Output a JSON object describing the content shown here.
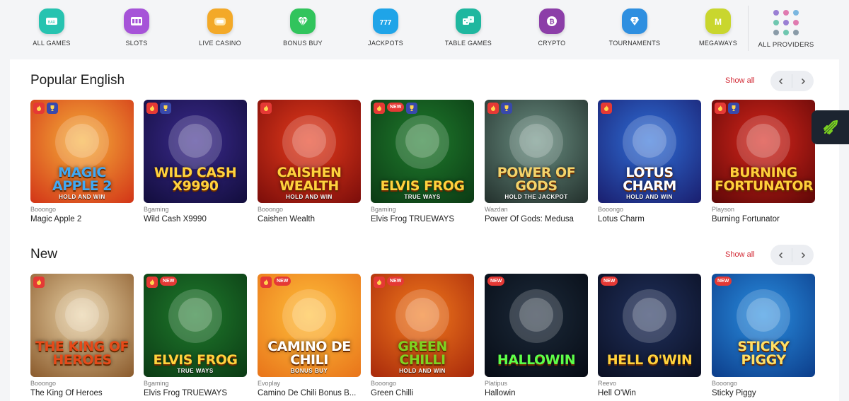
{
  "nav": {
    "categories": [
      {
        "label": "ALL GAMES",
        "icon": "all-games-icon",
        "color": "#27c3b0"
      },
      {
        "label": "SLOTS",
        "icon": "slots-icon",
        "color": "#a653d8"
      },
      {
        "label": "LIVE CASINO",
        "icon": "live-casino-icon",
        "color": "#f3a928"
      },
      {
        "label": "BONUS BUY",
        "icon": "diamond-icon",
        "color": "#31c45c"
      },
      {
        "label": "JACKPOTS",
        "icon": "jackpot-icon",
        "color": "#1fa4e8"
      },
      {
        "label": "TABLE GAMES",
        "icon": "dice-icon",
        "color": "#1fb79f"
      },
      {
        "label": "CRYPTO",
        "icon": "bitcoin-icon",
        "color": "#8c3ea8"
      },
      {
        "label": "TOURNAMENTS",
        "icon": "tournament-icon",
        "color": "#2e8fe0"
      },
      {
        "label": "MEGAWAYS",
        "icon": "megaways-icon",
        "color": "#c9d62e"
      }
    ],
    "providers_label": "ALL PROVIDERS",
    "provider_dot_colors": [
      "#9a7fd4",
      "#e07bb0",
      "#7ab7e0",
      "#6fc7b0",
      "#9a7fd4",
      "#e07bb0",
      "#8a9ba8",
      "#6fc7b0",
      "#8a9ba8"
    ]
  },
  "sections": [
    {
      "title": "Popular English",
      "show_all": "Show all",
      "games": [
        {
          "provider": "Booongo",
          "name": "Magic Apple 2",
          "art_title": "MAGIC APPLE 2",
          "art_sub": "HOLD AND WIN",
          "badges": [
            "hot",
            "cup"
          ],
          "bg": [
            "#f6b03a",
            "#d23417"
          ],
          "title_color": "#3fa9f5"
        },
        {
          "provider": "Bgaming",
          "name": "Wild Cash X9990",
          "art_title": "WILD CASH X9990",
          "art_sub": "",
          "badges": [
            "hot",
            "cup"
          ],
          "bg": [
            "#3a2a8c",
            "#120d3c"
          ],
          "title_color": "#ffd23d"
        },
        {
          "provider": "Booongo",
          "name": "Caishen Wealth",
          "art_title": "CAISHEN WEALTH",
          "art_sub": "HOLD AND WIN",
          "badges": [
            "hot"
          ],
          "bg": [
            "#e63b1c",
            "#7b0d0a"
          ],
          "title_color": "#ffd23d"
        },
        {
          "provider": "Bgaming",
          "name": "Elvis Frog TRUEWAYS",
          "art_title": "ELVIS FROG",
          "art_sub": "TRUE WAYS",
          "badges": [
            "hot",
            "new",
            "cup"
          ],
          "bg": [
            "#1f7a2c",
            "#0b3a14"
          ],
          "title_color": "#ffd23d"
        },
        {
          "provider": "Wazdan",
          "name": "Power Of Gods: Medusa",
          "art_title": "POWER OF GODS",
          "art_sub": "HOLD THE JACKPOT",
          "badges": [
            "hot",
            "cup"
          ],
          "bg": [
            "#6a8f82",
            "#23302c"
          ],
          "title_color": "#f3d36b"
        },
        {
          "provider": "Booongo",
          "name": "Lotus Charm",
          "art_title": "LOTUS CHARM",
          "art_sub": "HOLD AND WIN",
          "badges": [
            "hot"
          ],
          "bg": [
            "#2f6fd8",
            "#1a1e6e"
          ],
          "title_color": "#ffffff"
        },
        {
          "provider": "Playson",
          "name": "Burning Fortunator",
          "art_title": "BURNING FORTUNATOR",
          "art_sub": "",
          "badges": [
            "hot",
            "cup"
          ],
          "bg": [
            "#d7261b",
            "#5e0707"
          ],
          "title_color": "#ffcf3a"
        }
      ]
    },
    {
      "title": "New",
      "show_all": "Show all",
      "games": [
        {
          "provider": "Booongo",
          "name": "The King Of Heroes",
          "art_title": "THE KING OF HEROES",
          "art_sub": "",
          "badges": [
            "hot"
          ],
          "bg": [
            "#e9d2a5",
            "#8a5a2c"
          ],
          "title_color": "#e64a19"
        },
        {
          "provider": "Bgaming",
          "name": "Elvis Frog TRUEWAYS",
          "art_title": "ELVIS FROG",
          "art_sub": "TRUE WAYS",
          "badges": [
            "hot",
            "new"
          ],
          "bg": [
            "#1f7a2c",
            "#0b3a14"
          ],
          "title_color": "#ffd23d"
        },
        {
          "provider": "Evoplay",
          "name": "Camino De Chili Bonus B...",
          "art_title": "CAMINO DE CHILI",
          "art_sub": "BONUS BUY",
          "badges": [
            "hot",
            "new"
          ],
          "bg": [
            "#ffbf3a",
            "#e8741a"
          ],
          "title_color": "#ffffff"
        },
        {
          "provider": "Booongo",
          "name": "Green Chilli",
          "art_title": "GREEN CHILLI",
          "art_sub": "HOLD AND WIN",
          "badges": [
            "hot",
            "new"
          ],
          "bg": [
            "#f17a1d",
            "#a8290b"
          ],
          "title_color": "#7ed321"
        },
        {
          "provider": "Platipus",
          "name": "Hallowin",
          "art_title": "HALLOWIN",
          "art_sub": "",
          "badges": [
            "new"
          ],
          "bg": [
            "#1c2a3a",
            "#060b14"
          ],
          "title_color": "#5cff4a"
        },
        {
          "provider": "Reevo",
          "name": "Hell O'Win",
          "art_title": "HELL O'WIN",
          "art_sub": "",
          "badges": [
            "new"
          ],
          "bg": [
            "#20305c",
            "#0a0f22"
          ],
          "title_color": "#ffd23d"
        },
        {
          "provider": "Booongo",
          "name": "Sticky Piggy",
          "art_title": "STICKY PIGGY",
          "art_sub": "",
          "badges": [
            "new"
          ],
          "bg": [
            "#2a8ee0",
            "#0c3d8a"
          ],
          "title_color": "#ffe066"
        }
      ]
    }
  ],
  "colors": {
    "accent": "#d22a35",
    "sidebar_tab": "#1c2430",
    "sidebar_icon": "#7cd321"
  }
}
